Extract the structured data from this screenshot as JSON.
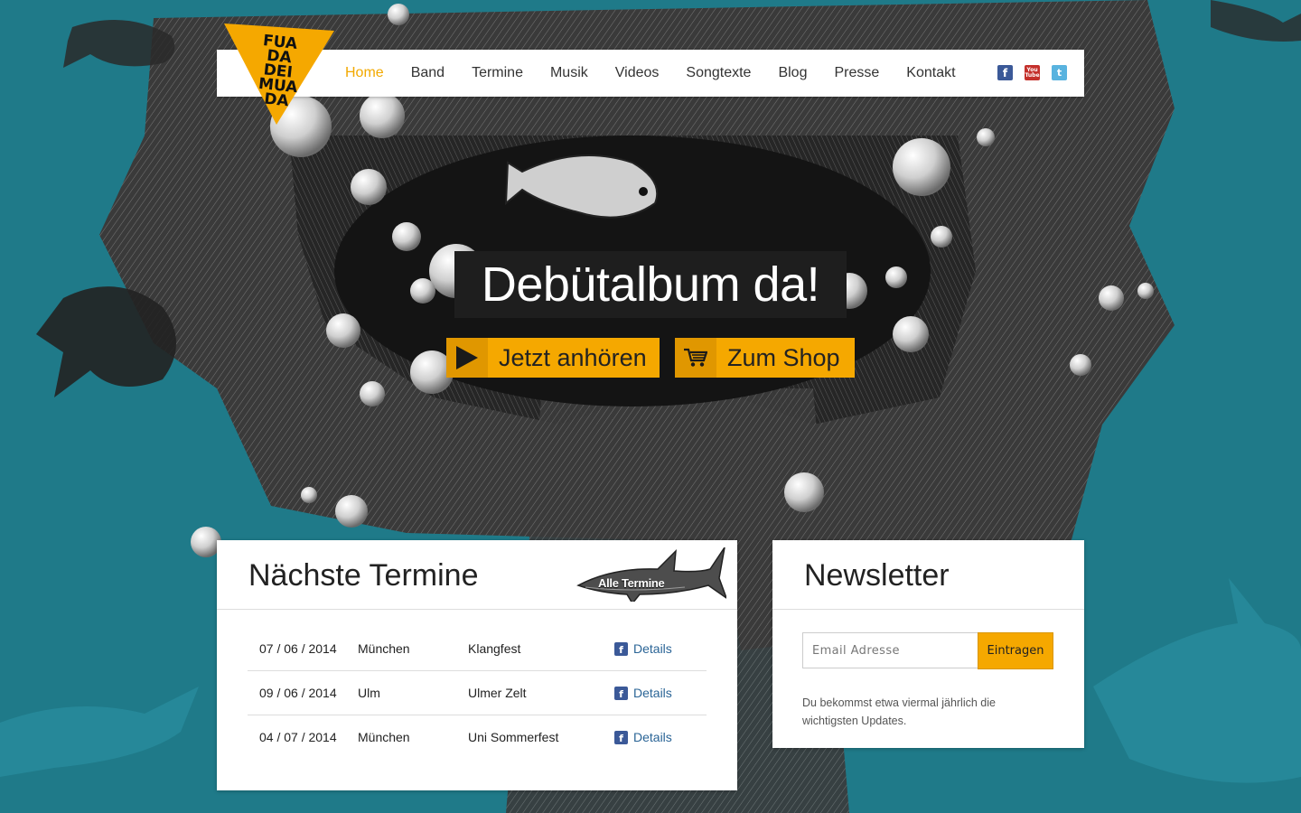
{
  "brand": {
    "logo_lines": [
      "FUA",
      "DA",
      "DEI",
      "MUA",
      "DA"
    ],
    "accent_color": "#f5a800",
    "background_color": "#1f7a89"
  },
  "nav": {
    "items": [
      {
        "label": "Home",
        "active": true
      },
      {
        "label": "Band"
      },
      {
        "label": "Termine"
      },
      {
        "label": "Musik"
      },
      {
        "label": "Videos"
      },
      {
        "label": "Songtexte"
      },
      {
        "label": "Blog"
      },
      {
        "label": "Presse"
      },
      {
        "label": "Kontakt"
      }
    ],
    "social": [
      {
        "name": "facebook-icon",
        "glyph": "f"
      },
      {
        "name": "youtube-icon",
        "glyph_top": "You",
        "glyph_bottom": "Tube"
      },
      {
        "name": "twitter-icon",
        "glyph": "t"
      }
    ]
  },
  "hero": {
    "title": "Debütalbum da!",
    "listen_label": "Jetzt anhören",
    "shop_label": "Zum Shop"
  },
  "dates_panel": {
    "title": "Nächste Termine",
    "all_dates_label": "Alle Termine",
    "rows": [
      {
        "date": "07 / 06 / 2014",
        "city": "München",
        "event": "Klangfest",
        "link": "Details"
      },
      {
        "date": "09 / 06 / 2014",
        "city": "Ulm",
        "event": "Ulmer Zelt",
        "link": "Details"
      },
      {
        "date": "04 / 07 / 2014",
        "city": "München",
        "event": "Uni Sommerfest",
        "link": "Details"
      }
    ]
  },
  "newsletter": {
    "title": "Newsletter",
    "email_placeholder": "Email Adresse",
    "email_value": "",
    "submit_label": "Eintragen",
    "note": "Du bekommst etwa viermal jährlich die wichtigsten Updates."
  }
}
